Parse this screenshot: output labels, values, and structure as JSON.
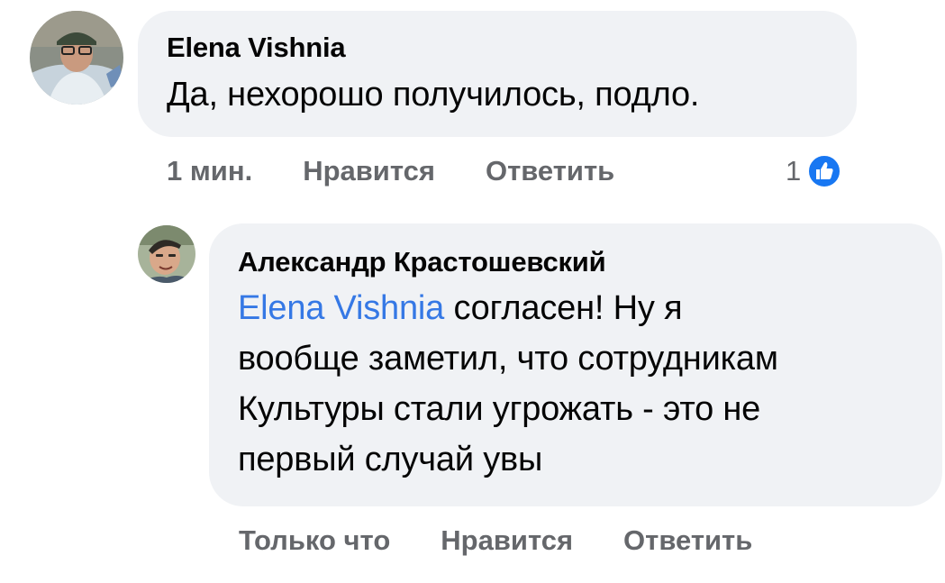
{
  "comments": [
    {
      "author": "Elena Vishnia",
      "text": "Да, нехорошо получилось, подло.",
      "actions": {
        "timestamp": "1 мин.",
        "like_label": "Нравится",
        "reply_label": "Ответить"
      },
      "reactions": {
        "count": "1",
        "icon": "like-icon",
        "color": "#1877f2"
      }
    },
    {
      "author": "Александр Крастошевский",
      "mention": "Elena Vishnia",
      "text_line1_rest": " согласен! Ну я",
      "text_line2": "вообще заметил, что сотрудникам",
      "text_line3": "Культуры стали угрожать - это не",
      "text_line4": "первый случай увы",
      "actions": {
        "timestamp": "Только что",
        "like_label": "Нравится",
        "reply_label": "Ответить"
      }
    }
  ],
  "colors": {
    "bubble": "#f0f2f5",
    "text": "#050505",
    "secondary": "#65676b",
    "mention": "#3578e5"
  }
}
